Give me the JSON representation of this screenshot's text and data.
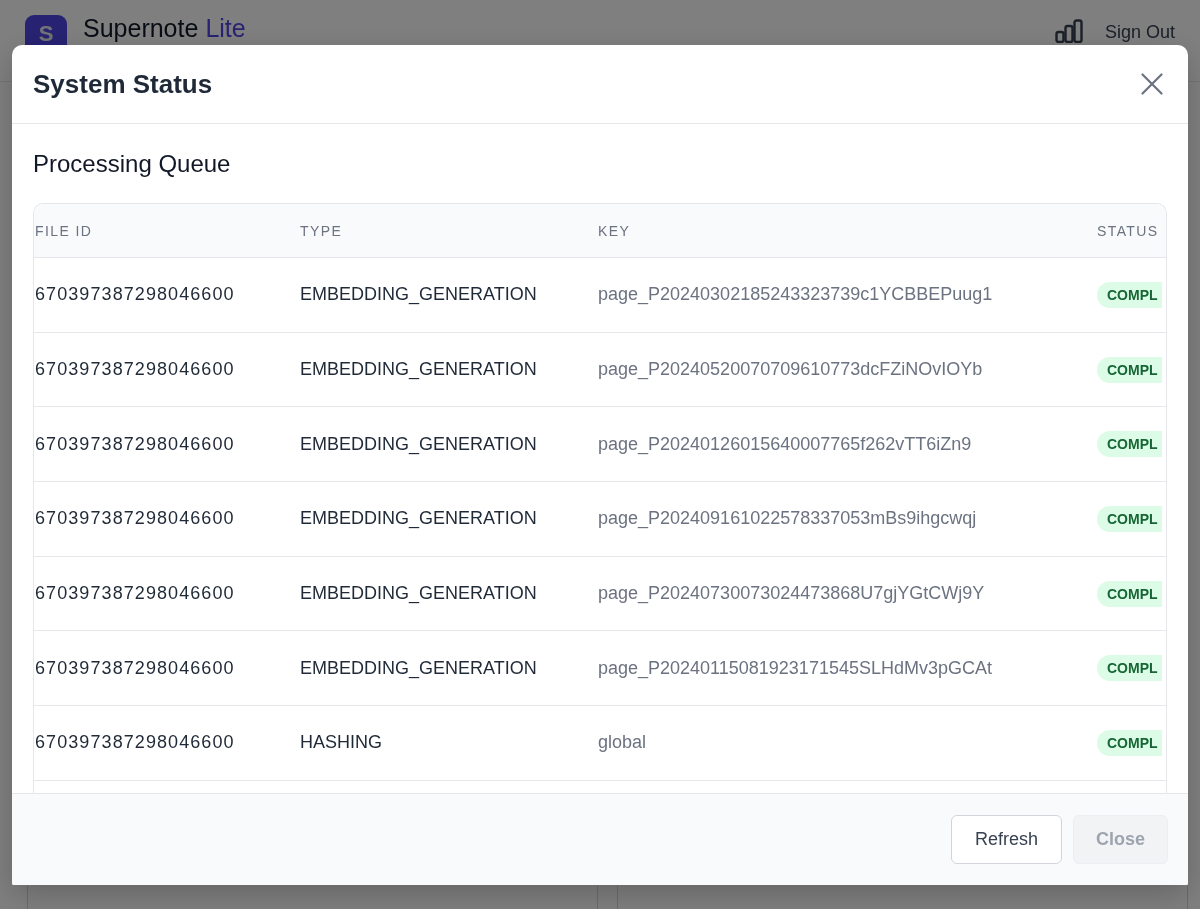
{
  "app_header": {
    "logo": "S",
    "brand": {
      "name": "Supernote",
      "suffix": "Lite"
    },
    "sign_out": "Sign Out"
  },
  "modal": {
    "title": "System Status",
    "section_title": "Processing Queue",
    "table": {
      "columns": [
        "FILE ID",
        "TYPE",
        "KEY",
        "STATUS"
      ],
      "rows": [
        {
          "file_id": "670397387298046600",
          "type": "EMBEDDING_GENERATION",
          "key": "page_P20240302185243323739c1YCBBEPuug1",
          "status": "COMPL"
        },
        {
          "file_id": "670397387298046600",
          "type": "EMBEDDING_GENERATION",
          "key": "page_P20240520070709610773dcFZiNOvIOYb",
          "status": "COMPL"
        },
        {
          "file_id": "670397387298046600",
          "type": "EMBEDDING_GENERATION",
          "key": "page_P20240126015640007765f262vTT6iZn9",
          "status": "COMPL"
        },
        {
          "file_id": "670397387298046600",
          "type": "EMBEDDING_GENERATION",
          "key": "page_P202409161022578337053mBs9ihgcwqj",
          "status": "COMPL"
        },
        {
          "file_id": "670397387298046600",
          "type": "EMBEDDING_GENERATION",
          "key": "page_P20240730073024473868U7gjYGtCWj9Y",
          "status": "COMPL"
        },
        {
          "file_id": "670397387298046600",
          "type": "EMBEDDING_GENERATION",
          "key": "page_P20240115081923171545SLHdMv3pGCAt",
          "status": "COMPL"
        },
        {
          "file_id": "670397387298046600",
          "type": "HASHING",
          "key": "global",
          "status": "COMPL"
        }
      ]
    },
    "buttons": [
      {
        "label": "Refresh",
        "kind": "secondary",
        "disabled": false
      },
      {
        "label": "Close",
        "kind": "primary",
        "disabled": true
      }
    ]
  }
}
